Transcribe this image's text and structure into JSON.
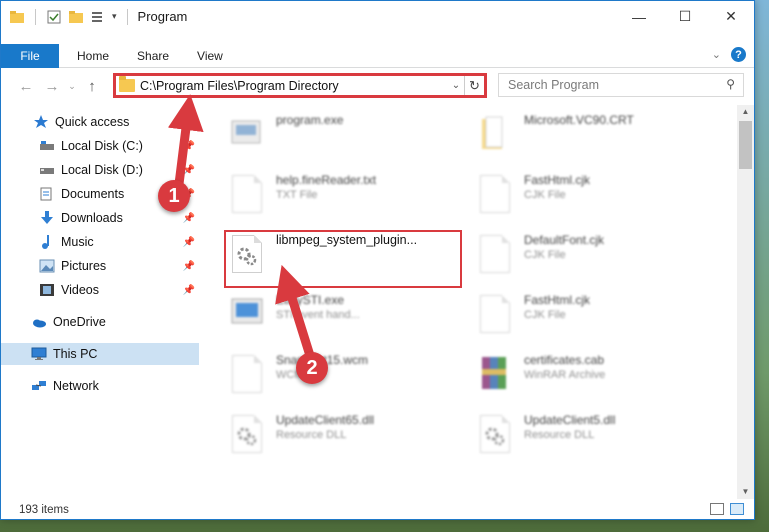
{
  "window": {
    "title": "Program",
    "controls": {
      "minimize": "—",
      "maximize": "☐",
      "close": "✕"
    }
  },
  "ribbon": {
    "tabs": [
      "File",
      "Home",
      "Share",
      "View"
    ],
    "help": "?"
  },
  "navigation": {
    "address": "C:\\Program Files\\Program Directory",
    "search_placeholder": "Search Program"
  },
  "sidebar": {
    "items": [
      {
        "label": "Quick access",
        "icon": "star-icon",
        "pinned": false
      },
      {
        "label": "Local Disk (C:)",
        "icon": "drive-icon",
        "pinned": true
      },
      {
        "label": "Local Disk (D:)",
        "icon": "drive-icon",
        "pinned": true
      },
      {
        "label": "Documents",
        "icon": "documents-icon",
        "pinned": true
      },
      {
        "label": "Downloads",
        "icon": "download-icon",
        "pinned": true
      },
      {
        "label": "Music",
        "icon": "music-icon",
        "pinned": true
      },
      {
        "label": "Pictures",
        "icon": "pictures-icon",
        "pinned": true
      },
      {
        "label": "Videos",
        "icon": "videos-icon",
        "pinned": true
      },
      {
        "label": "OneDrive",
        "icon": "cloud-icon",
        "pinned": false
      },
      {
        "label": "This PC",
        "icon": "computer-icon",
        "pinned": false,
        "active": true
      },
      {
        "label": "Network",
        "icon": "network-icon",
        "pinned": false
      }
    ]
  },
  "files": [
    {
      "name": "program.exe",
      "type": "",
      "icon": "exe-icon"
    },
    {
      "name": "Microsoft.VC90.CRT",
      "type": "",
      "icon": "folder-icon"
    },
    {
      "name": "help.fineReader.txt",
      "type": "TXT File",
      "icon": "text-file-icon"
    },
    {
      "name": "FastHtml.cjk",
      "type": "CJK File",
      "icon": "file-icon"
    },
    {
      "name": "libmpeg_system_plugin...",
      "type": "",
      "icon": "dll-gear-icon"
    },
    {
      "name": "DefaultFont.cjk",
      "type": "CJK File",
      "icon": "file-icon"
    },
    {
      "name": "EasySTI.exe",
      "type": "STI event hand...",
      "icon": "exe-icon"
    },
    {
      "name": "FastHtml.cjk",
      "type": "CJK File",
      "icon": "file-icon"
    },
    {
      "name": "Snapshot15.wcm",
      "type": "WCM File",
      "icon": "file-icon"
    },
    {
      "name": "certificates.cab",
      "type": "WinRAR Archive",
      "icon": "archive-icon"
    },
    {
      "name": "UpdateClient65.dll",
      "type": "Resource DLL",
      "icon": "dll-gear-icon"
    },
    {
      "name": "UpdateClient5.dll",
      "type": "Resource DLL",
      "icon": "dll-gear-icon"
    }
  ],
  "status": {
    "item_count": "193 items"
  },
  "annotations": {
    "step1": "1",
    "step2": "2"
  },
  "colors": {
    "accent": "#1979ca",
    "highlight": "#d93a3f",
    "selected": "#cce1f3"
  }
}
